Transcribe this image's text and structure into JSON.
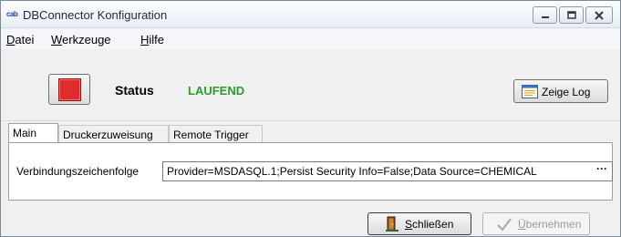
{
  "window": {
    "app_icon_text": "cab",
    "title": "DBConnector Konfiguration",
    "buttons": {
      "minimize": "minimize",
      "maximize": "maximize",
      "close": "close"
    }
  },
  "menu": {
    "items": [
      {
        "label": "Datei",
        "mnemonic": "D"
      },
      {
        "label": "Werkzeuge",
        "mnemonic": "W"
      },
      {
        "label": "Hilfe",
        "mnemonic": "H"
      }
    ]
  },
  "status": {
    "label": "Status",
    "value": "LAUFEND",
    "value_color": "#2a9d2a",
    "stop_color": "#e02c2c"
  },
  "log_button": {
    "label": "Zeige Log",
    "icon": "log-window-icon"
  },
  "tabs": [
    {
      "label": "Main",
      "active": true
    },
    {
      "label": "Druckerzuweisung",
      "active": false
    },
    {
      "label": "Remote Trigger",
      "active": false
    }
  ],
  "main": {
    "connection_label": "Verbindungszeichenfolge",
    "connection_value": "Provider=MSDASQL.1;Persist Security Info=False;Data Source=CHEMICAL",
    "browse_label": "···"
  },
  "footer": {
    "close_label": "Schließen",
    "close_mnemonic": "S",
    "apply_label": "Übernehmen",
    "apply_mnemonic": "Ü",
    "apply_enabled": false
  }
}
